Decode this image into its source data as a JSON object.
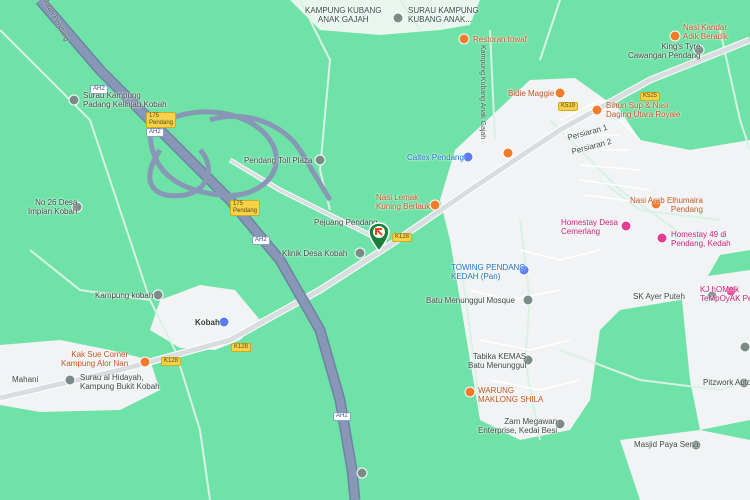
{
  "map": {
    "place_labels": {
      "kampung_kubang_anak_gajah": "KAMPUNG KUBANG\nANAK GAJAH",
      "surau_kampung_kubang_anak": "SURAU KAMPUNG\nKUBANG ANAK...",
      "restoran_towaf": "Restoran towaf",
      "nasi_kandar": "Nasi Kandar\nAdik Beradik",
      "kings_tyre": "King's Tyre\nCawangan Pendang",
      "surau_padang": "Surau Kampung\nPadang Kelinjau Kobah",
      "bidie_maggie": "Bidie Maggie",
      "bihun_sup": "Bihun Sup & Nasi\nDaging Utara Royale",
      "persiaran_1": "Persiaran 1",
      "persiaran_2": "Persiaran 2",
      "pendang_toll_plaza": "Pendang Toll Plaza",
      "caltex_pendang": "Caltex Pendang",
      "nasi_lemak": "Nasi Lemak\nKuning Berlauk",
      "nasi_arab": "Nasi Arab Elhumaira\nPendang",
      "no26": "No 26 Desa\nImpian Kobah",
      "pejuang_pendang": "Pejuang Pendang",
      "homestay_desa": "Homestay Desa\nCemerlang",
      "homestay_49": "Homestay 49 di\nPendang, Kedah",
      "klinik_desa_kobah": "Klinik Desa Kobah",
      "towing_pendang": "TOWING PENDANG\nKEDAH (Pan)",
      "kj_hmelk": "KJ hOMelk\nTeMpOyAK Peh",
      "batu_menunggul_mosque": "Batu Menunggul Mosque",
      "kampung_kobah": "Kampung kobah",
      "sk_ayer_puteh": "SK Ayer Puteh",
      "kobah": "Kobah",
      "kak_sue": "Kak Sue Corner\nKampung Alor Nan",
      "tabika": "Tabika KEMAS\nBatu Menunggul",
      "mahani": "Mahani",
      "surau_al_hidayah": "Surau al Hidayah,\nKampung Bukit Kobah",
      "warung_maklong": "WARUNG\nMAKLONG SHILA",
      "pitzwork": "Pitzwork Auto",
      "zam_megawan": "Zam Megawan\nEnterprise, Kedai Besi",
      "masjid_paya_sena": "Masjid Paya Sena"
    },
    "road_labels": {
      "kampung_kubang_anak_gajah_rd": "Kampung Kubang Anak Gajah",
      "top_left_road": "Jalan Pendang"
    },
    "route_shields": {
      "ah2_a": "AH2",
      "ah2_b": "AH2",
      "ah2_c": "AH2",
      "ah2_d": "AH2",
      "r175_a": "175\nPendang",
      "r175_b": "175\nPendang",
      "k128_a": "K128",
      "k128_b": "K128",
      "k128_c": "K128",
      "k519": "K519",
      "k525": "K525"
    },
    "colors": {
      "background": "#6fe2a7",
      "built_area": "#f1f3f4",
      "highway": "#8797b5",
      "main_road": "#d9dde0",
      "marker": "#188038"
    }
  }
}
